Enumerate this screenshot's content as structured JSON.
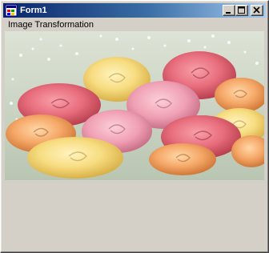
{
  "window": {
    "title": "Form1",
    "icon": "windows-form-icon",
    "buttons": [
      {
        "name": "minimize",
        "icon": "minimize-icon"
      },
      {
        "name": "maximize",
        "icon": "maximize-icon"
      },
      {
        "name": "close",
        "icon": "close-icon"
      }
    ],
    "title_color_start": "#0a246a",
    "title_color_end": "#a6caf0",
    "face_color": "#d4d0c8"
  },
  "form": {
    "caption": "Image Transformation",
    "picture_icon": "rose-bouquet-image"
  }
}
